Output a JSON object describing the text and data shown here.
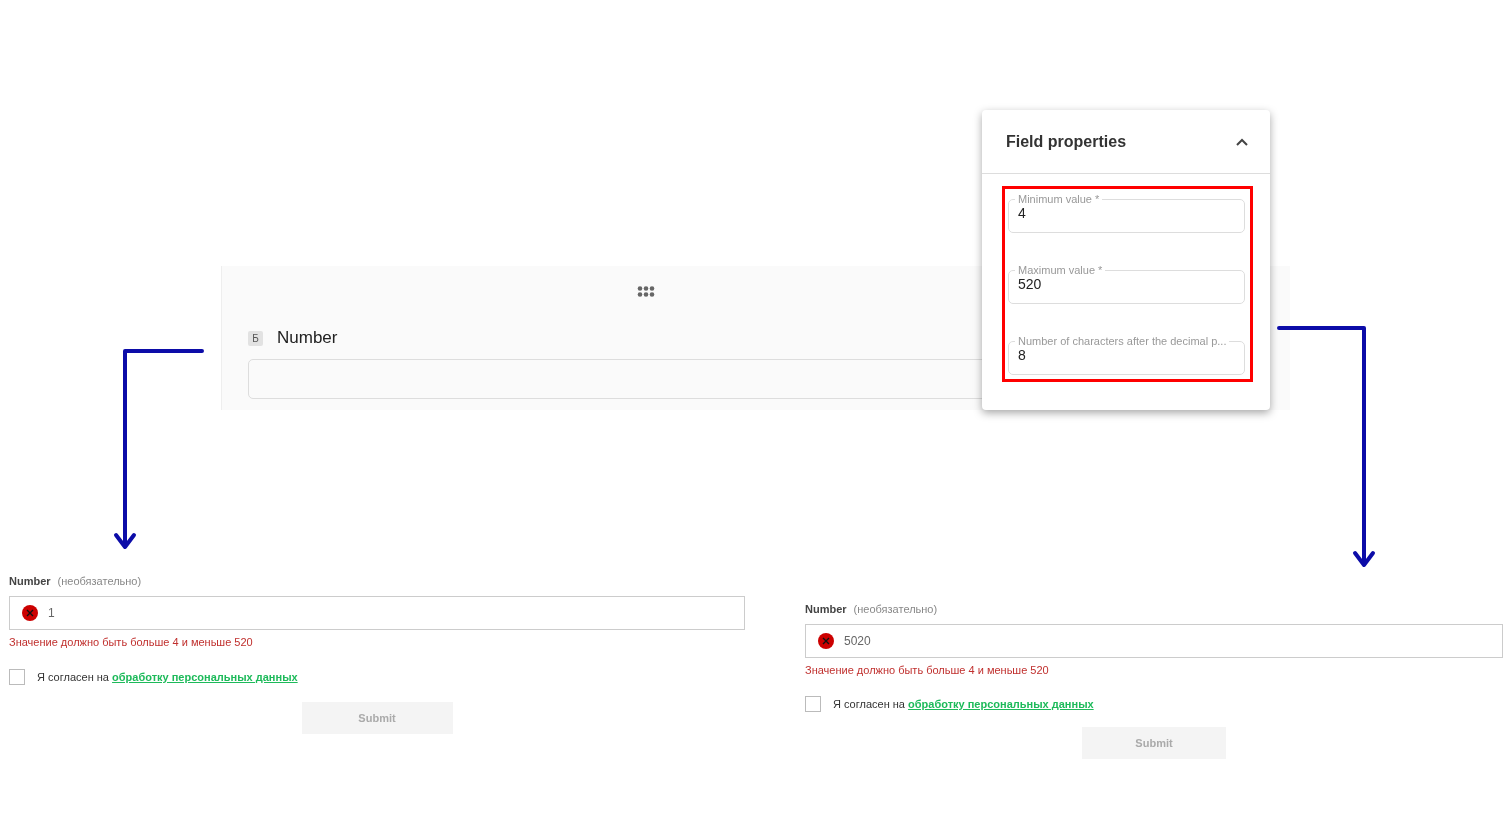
{
  "builder": {
    "badge": "Б",
    "label": "Number"
  },
  "field_properties": {
    "title": "Field properties",
    "expanded": true,
    "fields": [
      {
        "label": "Minimum value *",
        "value": "4"
      },
      {
        "label": "Maximum value *",
        "value": "520"
      },
      {
        "label": "Number of characters after the decimal p...",
        "value": "8"
      }
    ]
  },
  "previews": [
    {
      "label": "Number",
      "hint": "(необязательно)",
      "value": "1",
      "invalid": true,
      "error": "Значение должно быть больше 4 и меньше 520",
      "consent_text": "Я согласен на",
      "consent_link": "обработку персональных данных",
      "checked": false,
      "submit": "Submit"
    },
    {
      "label": "Number",
      "hint": "(необязательно)",
      "value": "5020",
      "invalid": true,
      "error": "Значение должно быть больше 4 и меньше 520",
      "consent_text": "Я согласен на",
      "consent_link": "обработку персональных данных",
      "checked": false,
      "submit": "Submit"
    }
  ]
}
